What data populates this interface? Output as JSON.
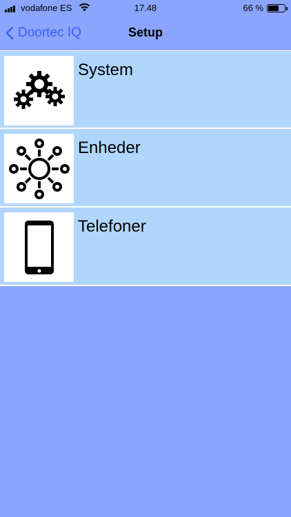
{
  "status": {
    "carrier": "vodafone ES",
    "time": "17.48",
    "battery_pct": "66 %",
    "battery_level": 0.66
  },
  "nav": {
    "back_label": "Doortec IQ",
    "title": "Setup",
    "accent_color": "#3b5ef5"
  },
  "items": [
    {
      "label": "System",
      "icon": "gears-icon"
    },
    {
      "label": "Enheder",
      "icon": "devices-hub-icon"
    },
    {
      "label": "Telefoner",
      "icon": "smartphone-icon"
    }
  ],
  "colors": {
    "background": "#8aa5fb",
    "row": "#b0d6fe"
  }
}
